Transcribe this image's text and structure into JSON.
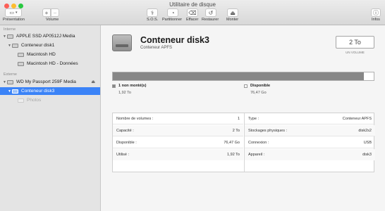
{
  "window": {
    "title": "Utilitaire de disque"
  },
  "toolbar": {
    "presentation_label": "Présentation",
    "volume_label": "Volume",
    "add_symbol": "+",
    "remove_symbol": "−",
    "sds_label": "S.O.S.",
    "partition_label": "Partitionner",
    "erase_label": "Effacer",
    "restore_label": "Restaurer",
    "mount_label": "Monter",
    "info_label": "Infos"
  },
  "sidebar": {
    "internal_header": "Interne",
    "external_header": "Externe",
    "items": [
      {
        "label": "APPLE SSD AP0512J Media"
      },
      {
        "label": "Conteneur disk1"
      },
      {
        "label": "Macintosh HD"
      },
      {
        "label": "Macintosh HD - Données"
      },
      {
        "label": "WD My Passport 259F Media"
      },
      {
        "label": "Conteneur disk3"
      },
      {
        "label": "Photos"
      }
    ]
  },
  "main": {
    "title": "Conteneur disk3",
    "subtitle": "Conteneur APFS",
    "capacity_value": "2 To",
    "capacity_caption": "UN VOLUME",
    "usage_fraction": 0.962,
    "legend": [
      {
        "label": "1 non monté(s)",
        "value": "1,92 To",
        "color": "#878787"
      },
      {
        "label": "Disponible",
        "value": "76,47 Go",
        "color": "#ffffff"
      }
    ],
    "info_left": [
      {
        "key": "Nombre de volumes :",
        "value": "1"
      },
      {
        "key": "Capacité :",
        "value": "2 To"
      },
      {
        "key": "Disponible :",
        "value": "76,47 Go"
      },
      {
        "key": "Utilisé :",
        "value": "1,92 To"
      }
    ],
    "info_right": [
      {
        "key": "Type :",
        "value": "Conteneur APFS"
      },
      {
        "key": "Stockages physiques :",
        "value": "disk2s2"
      },
      {
        "key": "Connexion :",
        "value": "USB"
      },
      {
        "key": "Appareil :",
        "value": "disk3"
      }
    ]
  },
  "colors": {
    "selection": "#3b83f7",
    "close": "#fc5f57",
    "minimize": "#fdbc2e",
    "zoom": "#28c840"
  }
}
